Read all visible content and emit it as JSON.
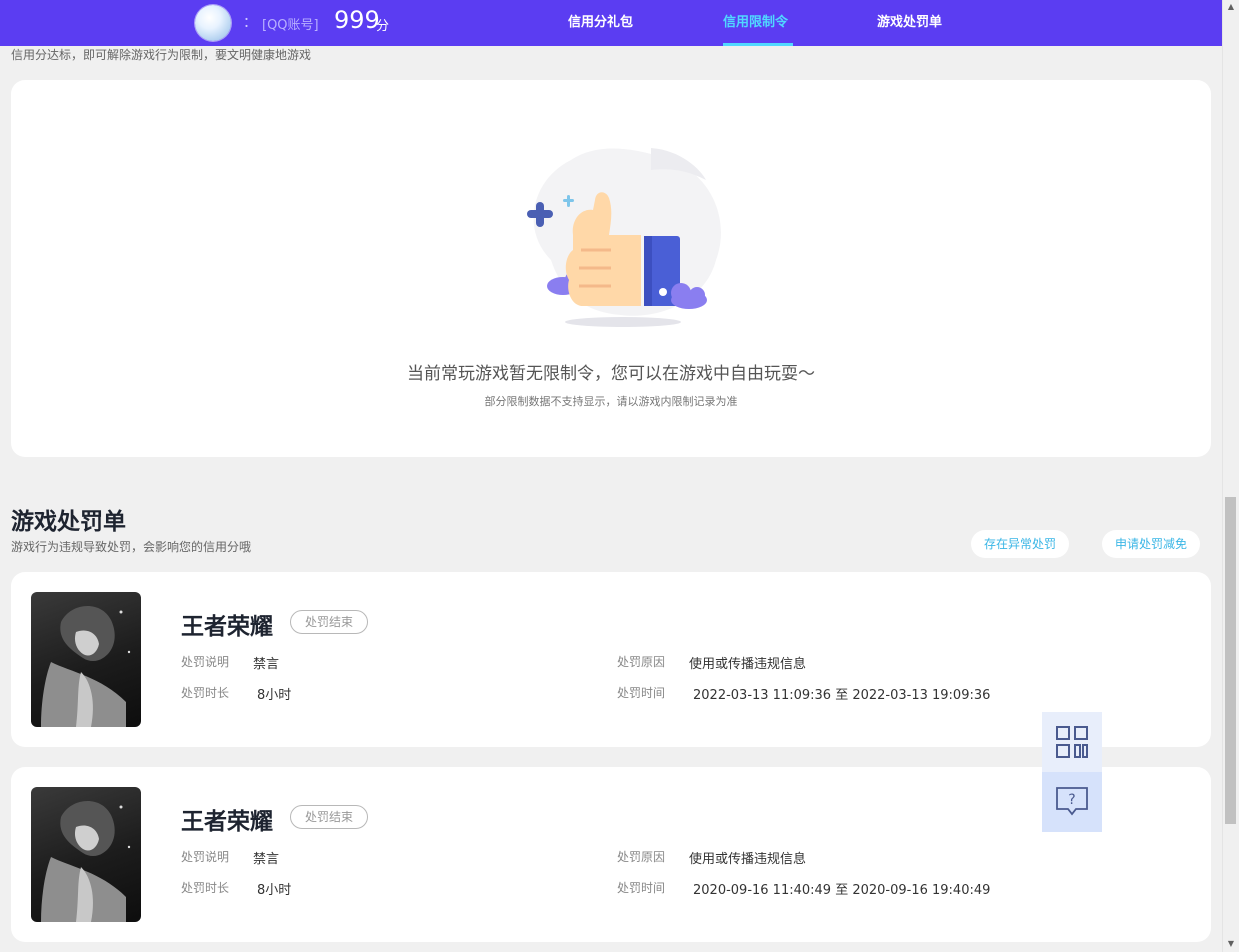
{
  "header": {
    "colon": "：",
    "account_label": "[QQ账号]",
    "score": "999",
    "score_unit": "分",
    "nav": [
      {
        "label": "信用分礼包",
        "active": false
      },
      {
        "label": "信用限制令",
        "active": true
      },
      {
        "label": "游戏处罚单",
        "active": false
      }
    ],
    "accent_color": "#5b3df2",
    "active_color": "#50d8ff"
  },
  "restriction_section": {
    "subtitle": "信用分达标，即可解除游戏行为限制，要文明健康地游戏",
    "empty_title": "当前常玩游戏暂无限制令，您可以在游戏中自由玩耍～",
    "empty_subtitle": "部分限制数据不支持显示，请以游戏内限制记录为准"
  },
  "penalty_section": {
    "title": "游戏处罚单",
    "subtitle": "游戏行为违规导致处罚，会影响您的信用分哦",
    "actions": [
      "存在异常处罚",
      "申请处罚减免"
    ],
    "records": [
      {
        "game": "王者荣耀",
        "status": "处罚结束",
        "desc_label": "处罚说明",
        "desc": "禁言",
        "duration_label": "处罚时长",
        "duration": "8小时",
        "reason_label": "处罚原因",
        "reason": "使用或传播违规信息",
        "time_label": "处罚时间",
        "time": "2022-03-13 11:09:36 至 2022-03-13 19:09:36"
      },
      {
        "game": "王者荣耀",
        "status": "处罚结束",
        "desc_label": "处罚说明",
        "desc": "禁言",
        "duration_label": "处罚时长",
        "duration": "8小时",
        "reason_label": "处罚原因",
        "reason": "使用或传播违规信息",
        "time_label": "处罚时间",
        "time": "2020-09-16 11:40:49 至 2020-09-16 19:40:49"
      }
    ]
  },
  "float_buttons": {
    "qr_icon": "qr-code-icon",
    "help_icon": "help-chat-icon",
    "help_glyph": "?"
  }
}
